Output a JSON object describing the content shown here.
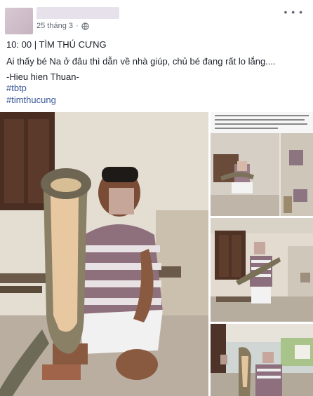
{
  "post": {
    "date": "25 tháng 3",
    "privacy_icon": "globe-icon",
    "more_icon": "more-dots-icon",
    "more_glyph": "• • •",
    "lines": [
      "10: 00 | TÌM THÚ CƯNG",
      "Ai thấy bé Na ở đâu thì dẫn về nhà giúp, chủ bé đang rất lo lắng....",
      "-Hieu hien Thuan-",
      "#tbtp",
      "#timthucung"
    ]
  },
  "photos": {
    "count": 4
  },
  "colors": {
    "link": "#385898",
    "meta": "#606770",
    "text": "#1d2129"
  }
}
